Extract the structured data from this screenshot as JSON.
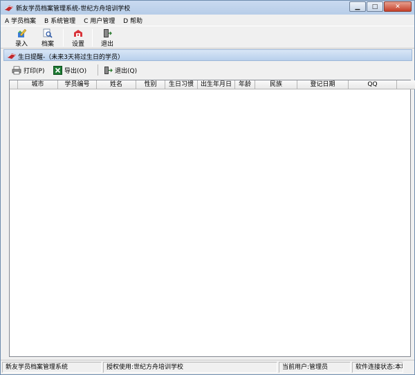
{
  "window": {
    "title": "新友学员档案管理系统-世纪方舟培训学校",
    "minimize_icon": "minimize-icon",
    "maximize_icon": "maximize-icon",
    "close_icon": "close-icon"
  },
  "menu": {
    "items": [
      {
        "label": "A 学员档案"
      },
      {
        "label": "B 系统管理"
      },
      {
        "label": "C 用户管理"
      },
      {
        "label": "D 帮助"
      }
    ]
  },
  "toolbar": {
    "items": [
      {
        "label": "录入",
        "icon": "pencil-entry-icon"
      },
      {
        "label": "档案",
        "icon": "magnifier-file-icon"
      },
      {
        "label": "设置",
        "icon": "settings-icon"
      },
      {
        "label": "退出",
        "icon": "exit-door-icon"
      }
    ]
  },
  "panel": {
    "title": "生日提醒-（未来3天将过生日的学员）",
    "icon": "book-icon"
  },
  "actions": {
    "print_label": "打印(P)",
    "export_label": "导出(O)",
    "exit_label": "退出(Q)"
  },
  "grid": {
    "columns": [
      "城市",
      "学员编号",
      "姓名",
      "性别",
      "生日习惯",
      "出生年月日",
      "年龄",
      "民族",
      "登记日期",
      "QQ",
      ""
    ],
    "rows": []
  },
  "status": {
    "app_name": "新友学员档案管理系统",
    "license": "授权使用:世纪方舟培训学校",
    "current_user": "当前用户:管理员",
    "connection": "软件连接状态:本地"
  },
  "colors": {
    "titlebar": "#c9daf0",
    "panel_header": "#b9d0ec",
    "close_button": "#c5402a"
  }
}
